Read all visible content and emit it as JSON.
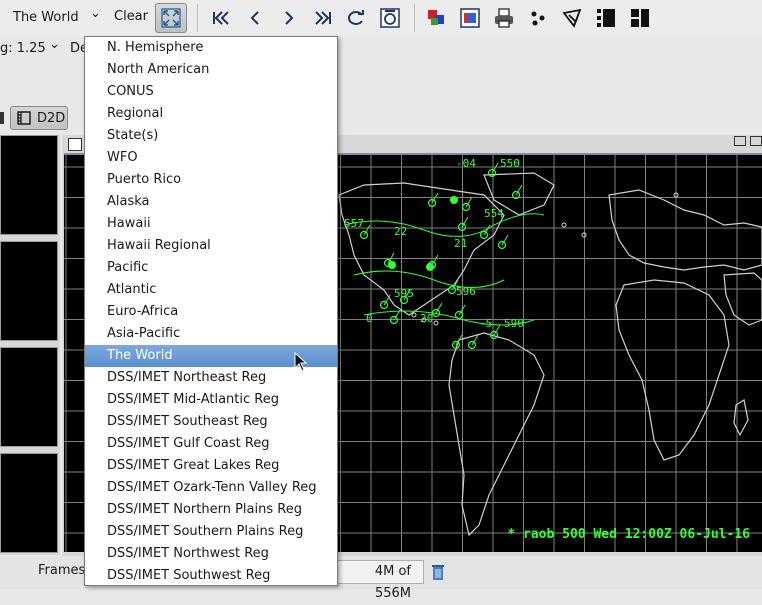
{
  "toolbar": {
    "scale_label": "The World",
    "scale_arrow": "⌄",
    "clear_label": "Clear",
    "icons": [
      "fit-zoom-icon",
      "first-frame-icon",
      "prev-frame-icon",
      "next-frame-icon",
      "last-frame-icon",
      "loop-icon",
      "time-options-icon",
      "image-properties-icon",
      "color-table-icon",
      "print-icon",
      "density-icon",
      "sample-icon",
      "panel-layout-icon",
      "panel-split-icon"
    ]
  },
  "row2": {
    "mag_label": "g: 1.25",
    "mag_arrow": "⌄",
    "density_label": "De"
  },
  "perspective": {
    "label": "D2D"
  },
  "map": {
    "caption": "* raob 500  Wed 12:00Z 06-Jul-16",
    "station_labels": [
      "-04",
      "550",
      "557",
      "22",
      "554",
      "21",
      "596",
      "-5",
      "590",
      "0",
      "20",
      "595"
    ],
    "overlay_color": "#33ff33",
    "coast_color": "#d0d0d0",
    "grid_color": "#808080"
  },
  "status": {
    "frames_label": "Frames",
    "memory": "4M of 556M"
  },
  "dropdown": {
    "items": [
      "N. Hemisphere",
      "North American",
      "CONUS",
      "Regional",
      "State(s)",
      "WFO",
      "Puerto Rico",
      "Alaska",
      "Hawaii",
      "Hawaii Regional",
      "Pacific",
      "Atlantic",
      "Euro-Africa",
      "Asia-Pacific",
      "The World",
      "DSS/IMET Northeast Reg",
      "DSS/IMET Mid-Atlantic Reg",
      "DSS/IMET Southeast Reg",
      "DSS/IMET Gulf Coast Reg",
      "DSS/IMET Great Lakes Reg",
      "DSS/IMET Ozark-Tenn Valley Reg",
      "DSS/IMET Northern Plains Reg",
      "DSS/IMET Southern Plains Reg",
      "DSS/IMET Northwest Reg",
      "DSS/IMET Southwest Reg"
    ],
    "selected_index": 14,
    "selected_color": "#5b8fd0"
  }
}
